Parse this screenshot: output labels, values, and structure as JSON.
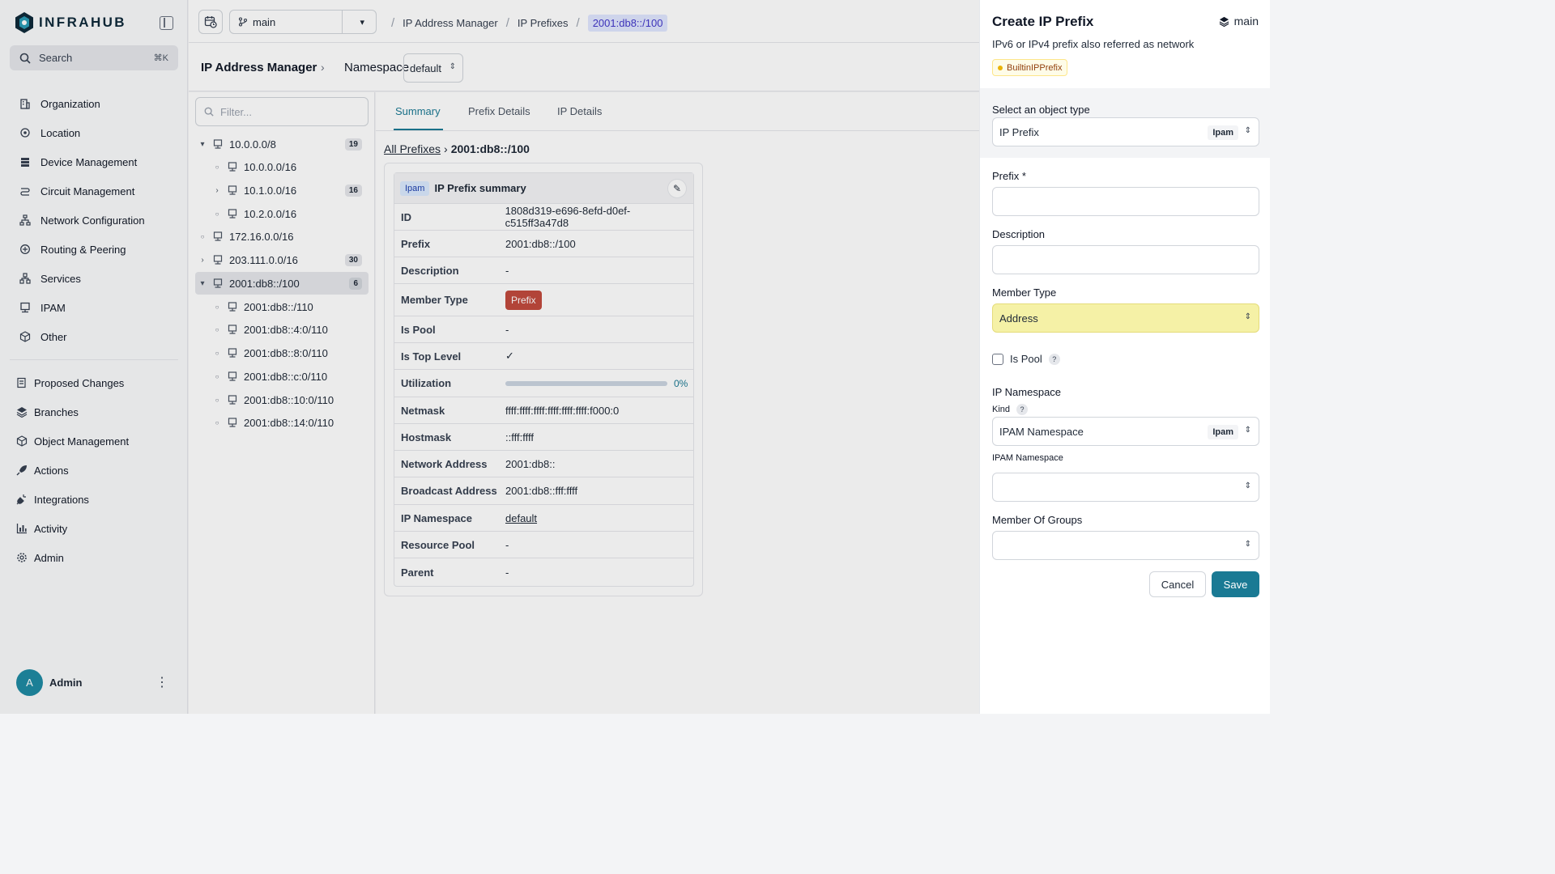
{
  "app": {
    "name": "INFRAHUB"
  },
  "sidebar": {
    "search_label": "Search",
    "search_shortcut": "⌘K",
    "items": [
      {
        "label": "Organization",
        "icon": "building-icon"
      },
      {
        "label": "Location",
        "icon": "location-pin-icon"
      },
      {
        "label": "Device Management",
        "icon": "server-icon"
      },
      {
        "label": "Circuit Management",
        "icon": "circuit-icon"
      },
      {
        "label": "Network Configuration",
        "icon": "network-icon"
      },
      {
        "label": "Routing & Peering",
        "icon": "routing-icon"
      },
      {
        "label": "Services",
        "icon": "hierarchy-icon"
      },
      {
        "label": "IPAM",
        "icon": "ipam-icon"
      },
      {
        "label": "Other",
        "icon": "cube-icon"
      }
    ],
    "items2": [
      {
        "label": "Proposed Changes",
        "icon": "proposed-changes-icon"
      },
      {
        "label": "Branches",
        "icon": "layers-icon"
      },
      {
        "label": "Object Management",
        "icon": "cube-icon"
      },
      {
        "label": "Actions",
        "icon": "rocket-icon"
      },
      {
        "label": "Integrations",
        "icon": "plug-icon"
      },
      {
        "label": "Activity",
        "icon": "bar-chart-icon"
      },
      {
        "label": "Admin",
        "icon": "gear-icon"
      }
    ],
    "user": {
      "initial": "A",
      "name": "Admin"
    }
  },
  "topbar": {
    "branch": "main",
    "breadcrumbs": [
      "IP Address Manager",
      "IP Prefixes",
      "2001:db8::/100"
    ]
  },
  "header": {
    "title": "IP Address Manager",
    "namespace_label": "Namespace",
    "namespace_value": "default"
  },
  "tree": {
    "filter_placeholder": "Filter...",
    "rows": [
      {
        "label": "10.0.0.0/8",
        "badge": "19"
      },
      {
        "label": "10.0.0.0/16",
        "badge": ""
      },
      {
        "label": "10.1.0.0/16",
        "badge": "16"
      },
      {
        "label": "10.2.0.0/16",
        "badge": ""
      },
      {
        "label": "172.16.0.0/16",
        "badge": ""
      },
      {
        "label": "203.111.0.0/16",
        "badge": "30"
      },
      {
        "label": "2001:db8::/100",
        "badge": "6"
      },
      {
        "label": "2001:db8::/110",
        "badge": ""
      },
      {
        "label": "2001:db8::4:0/110",
        "badge": ""
      },
      {
        "label": "2001:db8::8:0/110",
        "badge": ""
      },
      {
        "label": "2001:db8::c:0/110",
        "badge": ""
      },
      {
        "label": "2001:db8::10:0/110",
        "badge": ""
      },
      {
        "label": "2001:db8::14:0/110",
        "badge": ""
      }
    ]
  },
  "main": {
    "tabs": [
      "Summary",
      "Prefix Details",
      "IP Details"
    ],
    "crumb_link": "All Prefixes",
    "crumb_current": "2001:db8::/100",
    "card": {
      "namespace_badge": "Ipam",
      "title": "IP Prefix summary",
      "utilization_pct": "0%",
      "utilization_value": 0,
      "fields": [
        {
          "key": "ID",
          "value": "1808d319-e696-8efd-d0ef-c515ff3a47d8"
        },
        {
          "key": "Prefix",
          "value": "2001:db8::/100"
        },
        {
          "key": "Description",
          "value": "-"
        },
        {
          "key": "Member Type",
          "value": "Prefix"
        },
        {
          "key": "Is Pool",
          "value": "-"
        },
        {
          "key": "Is Top Level",
          "value": "✓"
        },
        {
          "key": "Utilization",
          "value": ""
        },
        {
          "key": "Netmask",
          "value": "ffff:ffff:ffff:ffff:ffff:ffff:f000:0"
        },
        {
          "key": "Hostmask",
          "value": "::fff:ffff"
        },
        {
          "key": "Network Address",
          "value": "2001:db8::"
        },
        {
          "key": "Broadcast Address",
          "value": "2001:db8::fff:ffff"
        },
        {
          "key": "IP Namespace",
          "value": "default"
        },
        {
          "key": "Resource Pool",
          "value": "-"
        },
        {
          "key": "Parent",
          "value": "-"
        }
      ]
    }
  },
  "drawer": {
    "title": "Create IP Prefix",
    "branch": "main",
    "subtitle": "IPv6 or IPv4 prefix also referred as network",
    "tag": "BuiltinIPPrefix",
    "object_type_label": "Select an object type",
    "object_type_value": "IP Prefix",
    "object_type_badge": "Ipam",
    "prefix_label": "Prefix *",
    "description_label": "Description",
    "member_type_label": "Member Type",
    "member_type_value": "Address",
    "is_pool_label": "Is Pool",
    "ip_namespace_label": "IP Namespace",
    "kind_label": "Kind",
    "kind_value": "IPAM Namespace",
    "kind_badge": "Ipam",
    "ipam_namespace_label": "IPAM Namespace",
    "member_of_groups_label": "Member Of Groups",
    "cancel_label": "Cancel",
    "save_label": "Save",
    "accent_color": "#1a7a94",
    "highlight_color": "#f5f1a6"
  }
}
